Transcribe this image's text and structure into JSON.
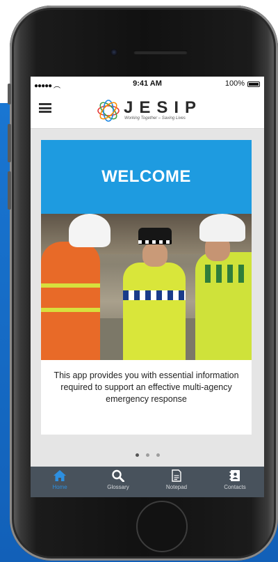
{
  "status_bar": {
    "signal": "●●●●● ",
    "time": "9:41 AM",
    "battery": "100%"
  },
  "header": {
    "logo_text": "JESIP",
    "logo_tagline": "Working Together – Saving Lives",
    "menu_icon": "hamburger-icon"
  },
  "carousel": {
    "banner_title": "WELCOME",
    "description": "This app provides you with essential information required to support an effective multi-agency emergency response",
    "page_count": 3,
    "active_page": 1
  },
  "tabs": [
    {
      "label": "Home",
      "icon": "home-icon",
      "active": true
    },
    {
      "label": "Glossary",
      "icon": "search-icon",
      "active": false
    },
    {
      "label": "Notepad",
      "icon": "notepad-icon",
      "active": false
    },
    {
      "label": "Contacts",
      "icon": "contacts-icon",
      "active": false
    }
  ],
  "colors": {
    "banner_blue": "#1e9be0",
    "tab_bar": "#48525c",
    "tab_active": "#2d8fe0",
    "background_blue": "#1565c0"
  }
}
